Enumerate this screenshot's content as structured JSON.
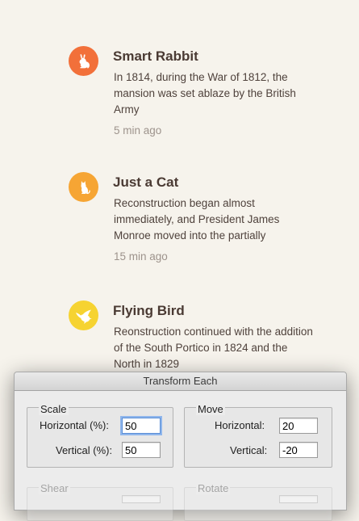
{
  "feed": [
    {
      "title": "Smart Rabbit",
      "body": "In 1814, during the War of 1812, the mansion was set ablaze by the British Army",
      "time": "5 min ago",
      "icon": "rabbit-icon",
      "color": "#f2703a"
    },
    {
      "title": "Just a Cat",
      "body": "Reconstruction began almost immediately, and President James Monroe moved into the partially",
      "time": "15 min ago",
      "icon": "cat-icon",
      "color": "#f6a534"
    },
    {
      "title": "Flying Bird",
      "body": "Reonstruction continued with the addition of the South Portico in 1824 and the North in 1829",
      "time": "",
      "icon": "bird-icon",
      "color": "#f6d331"
    }
  ],
  "dialog": {
    "title": "Transform Each",
    "scale": {
      "label": "Scale",
      "horizontal_label": "Horizontal (%):",
      "horizontal_value": "50",
      "vertical_label": "Vertical (%):",
      "vertical_value": "50"
    },
    "move": {
      "label": "Move",
      "horizontal_label": "Horizontal:",
      "horizontal_value": "20",
      "vertical_label": "Vertical:",
      "vertical_value": "-20"
    },
    "shear": {
      "label": "Shear"
    },
    "rotate": {
      "label": "Rotate"
    }
  }
}
